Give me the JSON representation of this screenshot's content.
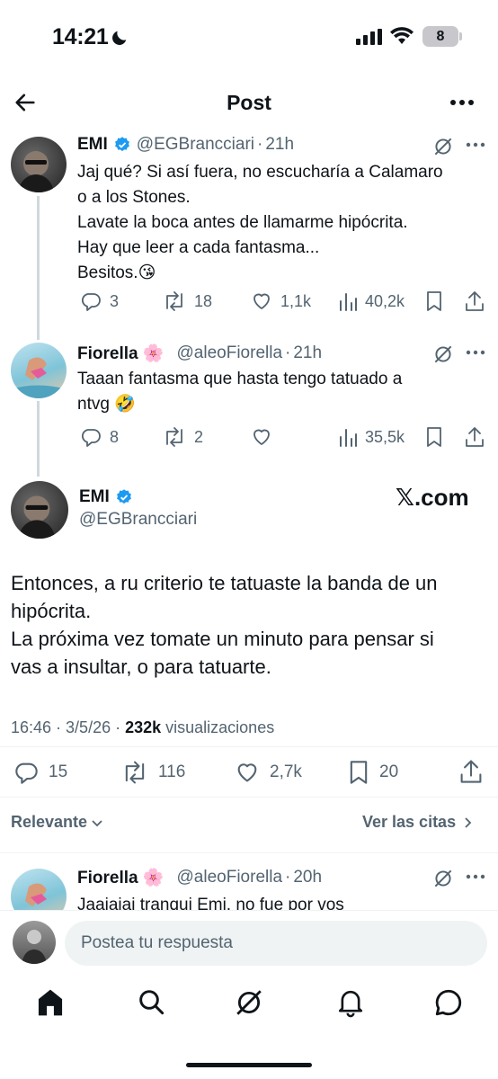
{
  "status_bar": {
    "time": "14:21",
    "battery": "8"
  },
  "nav": {
    "title": "Post"
  },
  "tweet1": {
    "name": "EMI",
    "handle": "@EGBrancciari",
    "time": "21h",
    "lines": [
      "Jaj qué? Si así fuera, no escucharía a Calamaro",
      "o a los Stones.",
      "Lavate la boca antes de llamarme hipócrita.",
      "Hay que leer a cada fantasma...",
      "Besitos.😘"
    ],
    "replies": "3",
    "reposts": "18",
    "likes": "1,1k",
    "views": "40,2k"
  },
  "tweet2": {
    "name": "Fiorella 🌸",
    "handle": "@aleoFiorella",
    "time": "21h",
    "lines": [
      "Taaan fantasma que hasta tengo tatuado a",
      "ntvg 🤣"
    ],
    "replies": "8",
    "reposts": "2",
    "views": "35,5k"
  },
  "main": {
    "name": "EMI",
    "handle": "@EGBrancciari",
    "logo": "𝕏.com",
    "lines": [
      "Entonces, a ru criterio te tatuaste la banda de un",
      "hipócrita.",
      "La próxima vez tomate un minuto para pensar si",
      "vas a insultar, o para tatuarte."
    ],
    "timestamp": "16:46 · 3/5/26 · ",
    "views_count": "232k",
    "views_label": " visualizaciones",
    "replies": "15",
    "reposts": "116",
    "likes": "2,7k",
    "bookmarks": "20"
  },
  "filters": {
    "relevance": "Relevante",
    "quotes": "Ver las citas"
  },
  "reply_preview": {
    "name": "Fiorella 🌸",
    "handle": "@aleoFiorella",
    "time": "20h",
    "text": "Jaajajaj tranqui Emi, no fue por vos"
  },
  "reply_input": {
    "placeholder": "Postea tu respuesta"
  },
  "colors": {
    "verified": "#1d9bf0",
    "text": "#0f1419",
    "secondary": "#536471"
  }
}
